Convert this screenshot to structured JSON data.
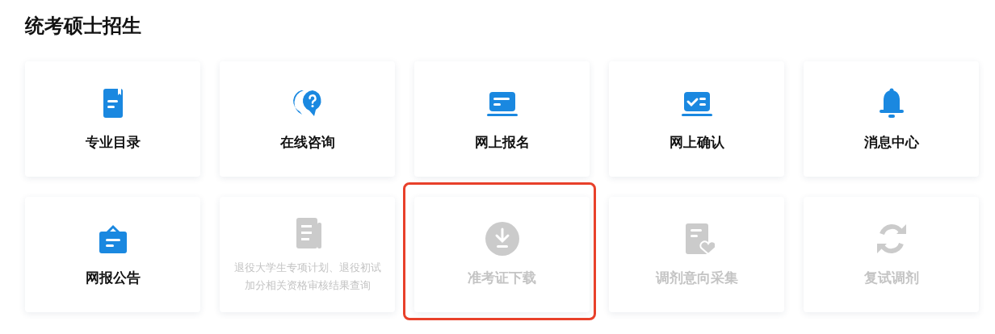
{
  "title": "统考硕士招生",
  "tiles": [
    {
      "label": "专业目录",
      "kind": "book",
      "disabled": false,
      "highlighted": false
    },
    {
      "label": "在线咨询",
      "kind": "question",
      "disabled": false,
      "highlighted": false
    },
    {
      "label": "网上报名",
      "kind": "laptop",
      "disabled": false,
      "highlighted": false
    },
    {
      "label": "网上确认",
      "kind": "laptop-check",
      "disabled": false,
      "highlighted": false
    },
    {
      "label": "消息中心",
      "kind": "bell",
      "disabled": false,
      "highlighted": false
    },
    {
      "label": "网报公告",
      "kind": "sign",
      "disabled": false,
      "highlighted": false
    },
    {
      "label": "退役大学生专项计划、退役初试加分相关资格审核结果查询",
      "kind": "document",
      "disabled": true,
      "highlighted": false
    },
    {
      "label": "准考证下载",
      "kind": "download",
      "disabled": true,
      "highlighted": true
    },
    {
      "label": "调剂意向采集",
      "kind": "heart-doc",
      "disabled": true,
      "highlighted": false
    },
    {
      "label": "复试调剂",
      "kind": "refresh",
      "disabled": true,
      "highlighted": false
    }
  ]
}
